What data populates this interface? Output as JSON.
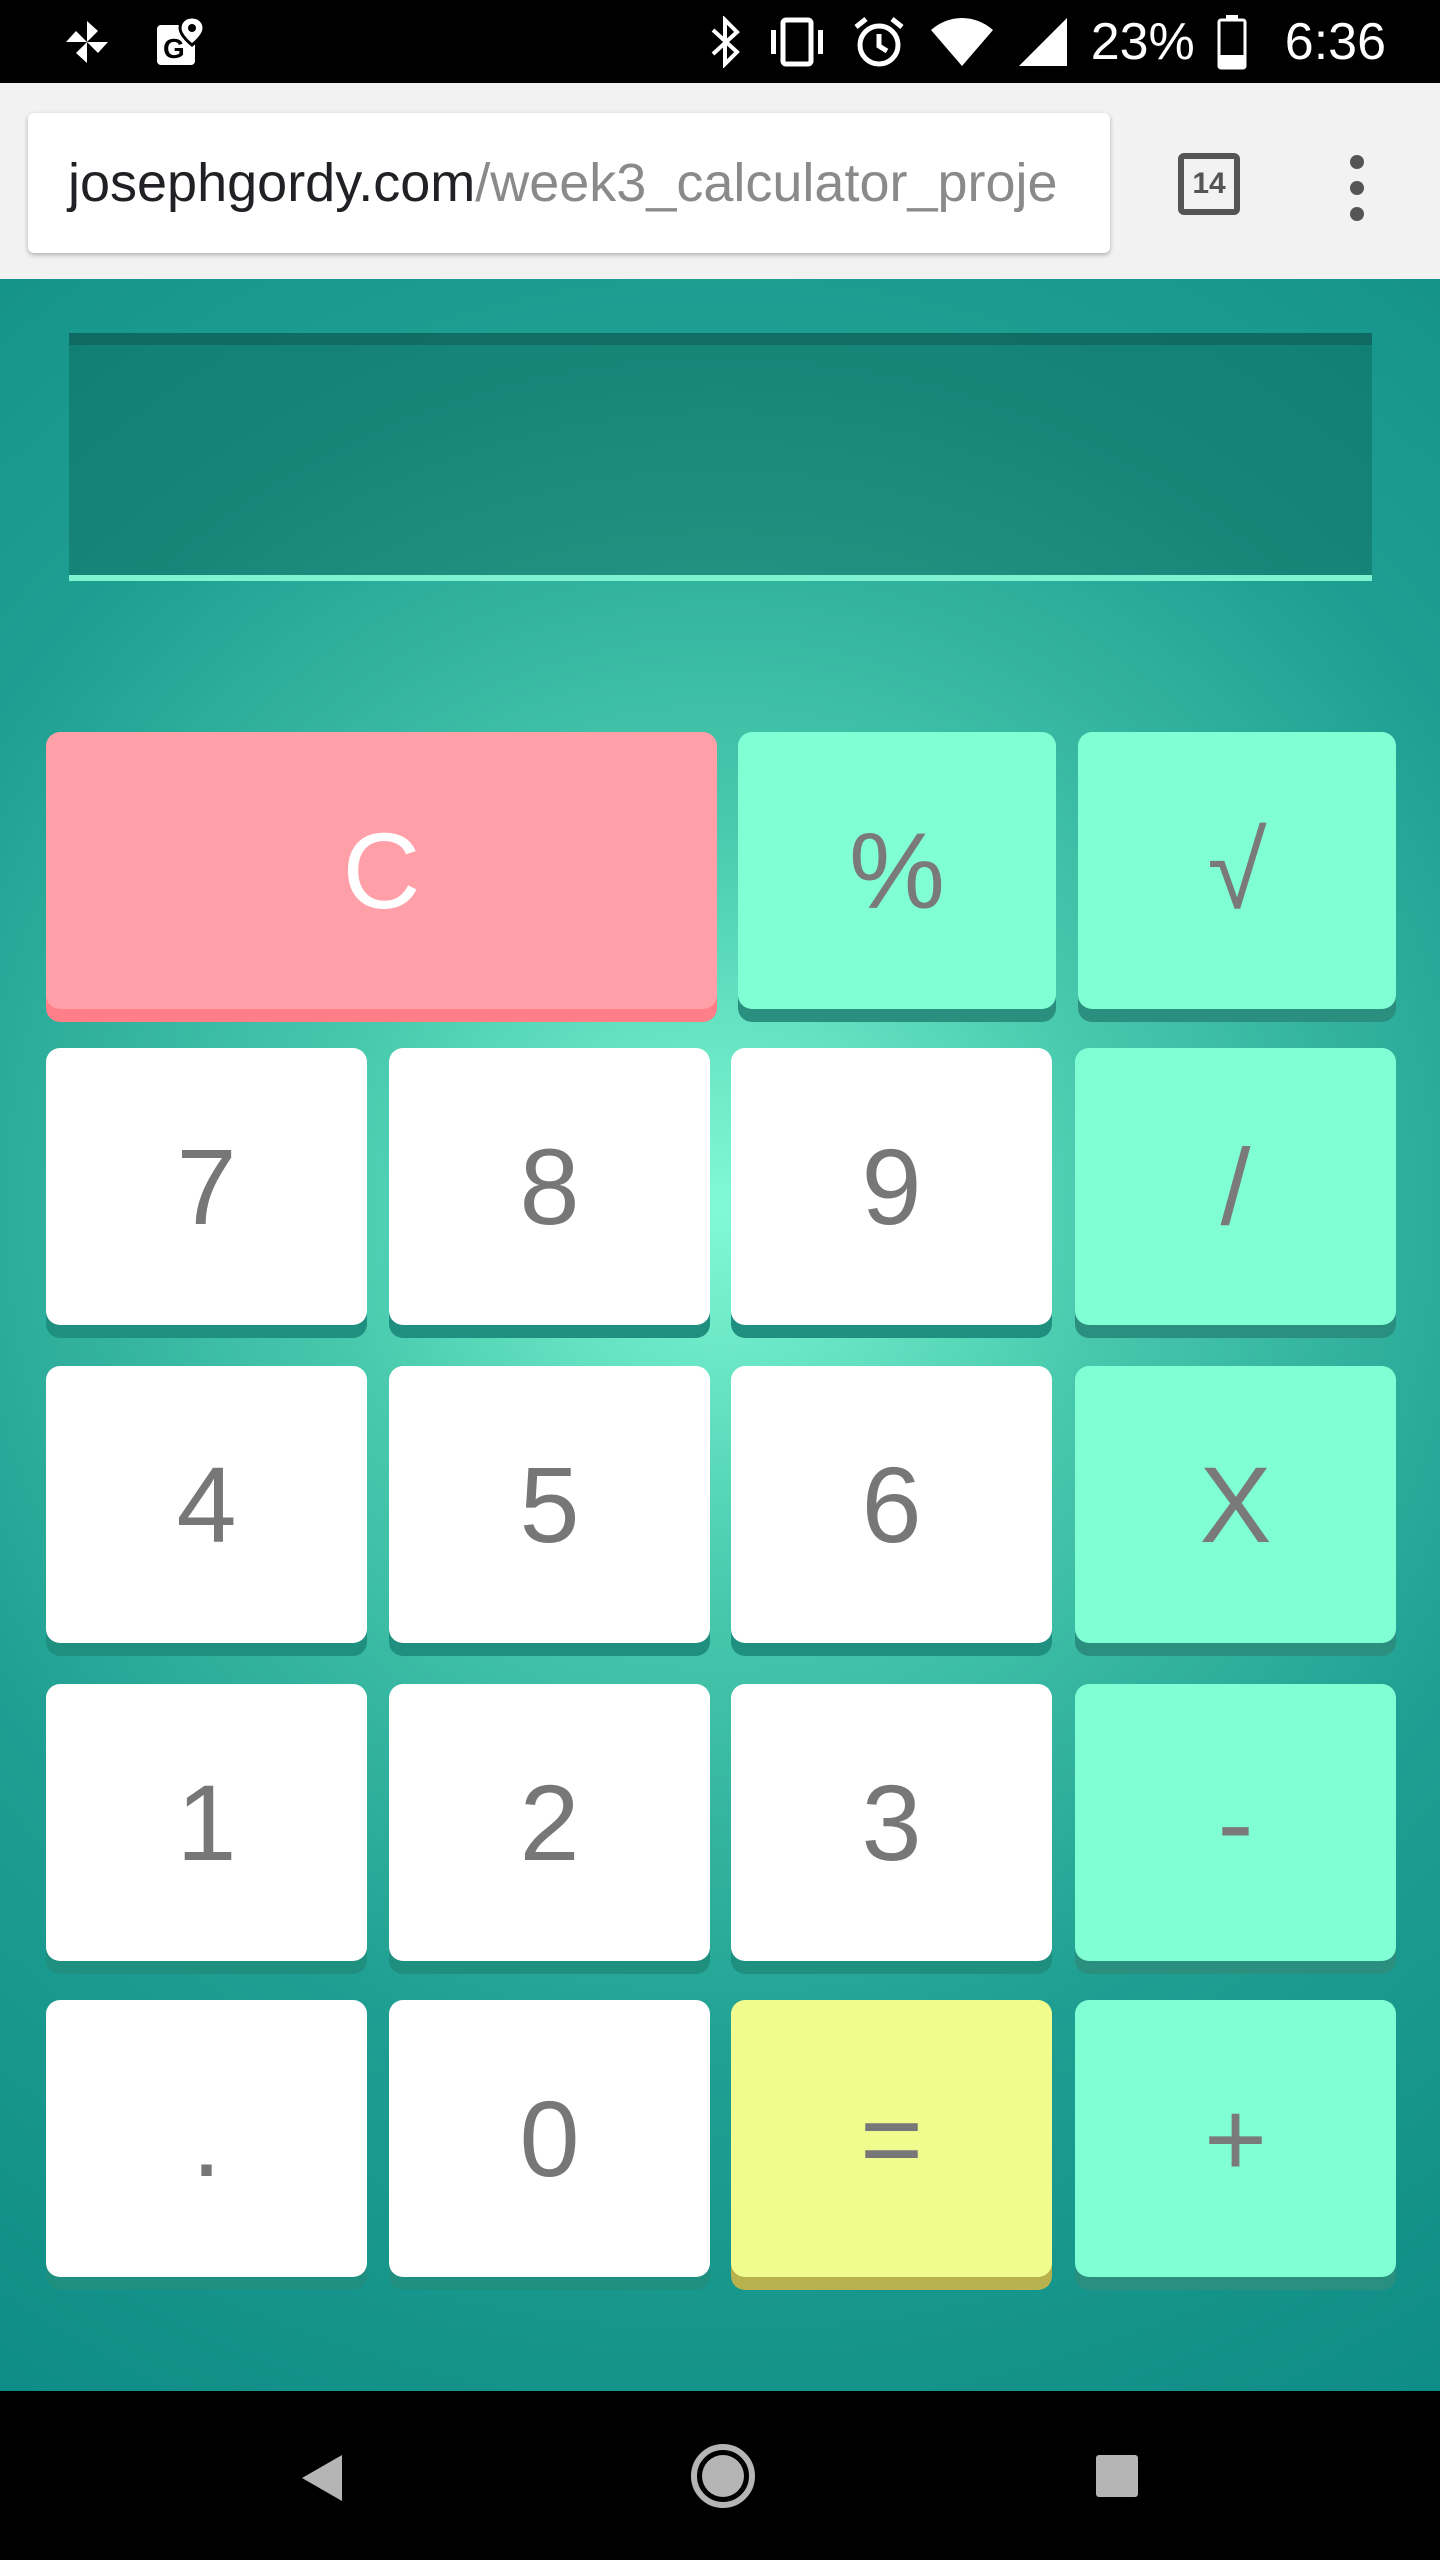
{
  "status_bar": {
    "battery_percent": "23%",
    "time": "6:36",
    "icons": [
      "pinwheel-icon",
      "google-maps-icon",
      "bluetooth-icon",
      "vibrate-icon",
      "alarm-icon",
      "wifi-icon",
      "signal-icon",
      "battery-icon"
    ]
  },
  "browser": {
    "url_domain": "josephgordy.com",
    "url_path": "/week3_calculator_proje",
    "tab_count": "14"
  },
  "calculator": {
    "display_value": "",
    "keys": {
      "clear": "C",
      "percent": "%",
      "sqrt": "√",
      "seven": "7",
      "eight": "8",
      "nine": "9",
      "divide": "/",
      "four": "4",
      "five": "5",
      "six": "6",
      "multiply": "X",
      "one": "1",
      "two": "2",
      "three": "3",
      "subtract": "-",
      "decimal": ".",
      "zero": "0",
      "equals": "=",
      "add": "+"
    }
  },
  "colors": {
    "number_key": "#ffffff",
    "operator_key": "#80ffd5",
    "clear_key": "#ffa0a8",
    "equals_key": "#f0fc8e",
    "background_teal": "#1f9f92"
  }
}
